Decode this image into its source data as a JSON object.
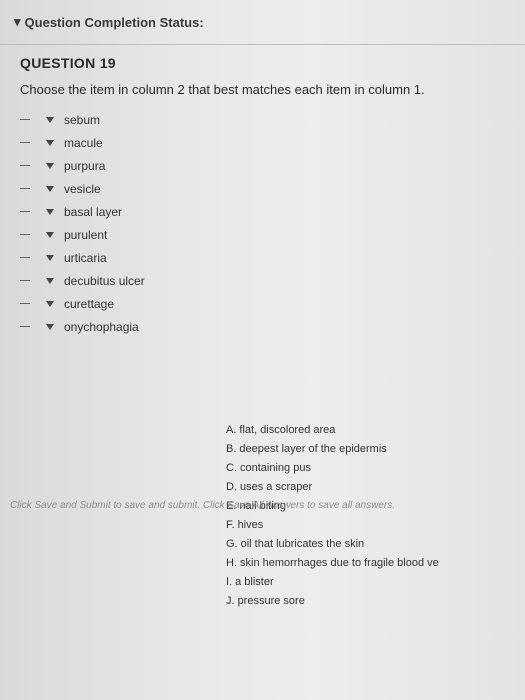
{
  "header": {
    "status_label": "Question Completion Status:"
  },
  "question": {
    "title": "QUESTION 19",
    "prompt": "Choose the item in column 2 that best matches each item in column 1."
  },
  "column1": [
    "sebum",
    "macule",
    "purpura",
    "vesicle",
    "basal layer",
    "purulent",
    "urticaria",
    "decubitus ulcer",
    "curettage",
    "onychophagia"
  ],
  "column2": [
    {
      "key": "A.",
      "text": "flat, discolored area"
    },
    {
      "key": "B.",
      "text": "deepest layer of the epidermis"
    },
    {
      "key": "C.",
      "text": "containing pus"
    },
    {
      "key": "D.",
      "text": "uses a scraper"
    },
    {
      "key": "E.",
      "text": "nail biting"
    },
    {
      "key": "F.",
      "text": "hives"
    },
    {
      "key": "G.",
      "text": "oil that lubricates the skin"
    },
    {
      "key": "H.",
      "text": "skin hemorrhages due to fragile blood ve"
    },
    {
      "key": "I.",
      "text": "a blister"
    },
    {
      "key": "J.",
      "text": "pressure sore"
    }
  ],
  "footer": {
    "text": "Click Save and Submit to save and submit. Click Save All Answers to save all answers."
  }
}
